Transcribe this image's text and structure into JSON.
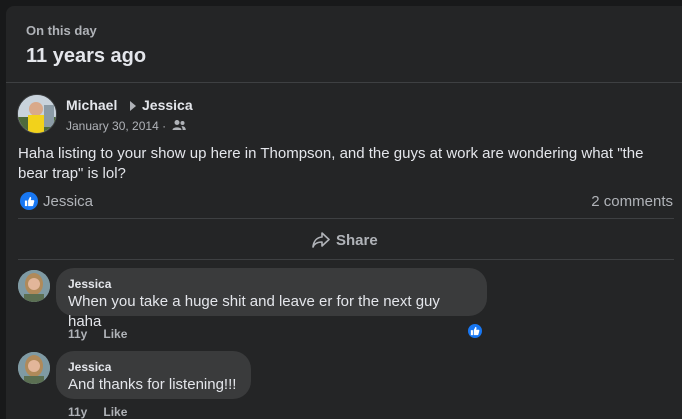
{
  "memory": {
    "label": "On this day",
    "years": "11 years ago"
  },
  "post": {
    "author": "Michael",
    "target": "Jessica",
    "date": "January 30, 2014 ·",
    "privacy_icon": "friends-icon",
    "text": "Haha listing to your show up here in Thompson, and the guys at work are wondering what \"the bear trap\" is lol?",
    "reaction_name": "Jessica",
    "comments_count": "2 comments",
    "share_label": "Share"
  },
  "comments": [
    {
      "author": "Jessica",
      "text": "When you take a huge shit and leave er for the next guy haha",
      "age": "11y",
      "like_label": "Like"
    },
    {
      "author": "Jessica",
      "text": "And thanks for listening!!!",
      "age": "11y",
      "like_label": "Like"
    }
  ],
  "colors": {
    "background": "#18191a",
    "card": "#242526",
    "bubble": "#3a3b3c",
    "accent": "#1877f2",
    "text": "#e4e6eb",
    "muted": "#b0b3b8"
  }
}
